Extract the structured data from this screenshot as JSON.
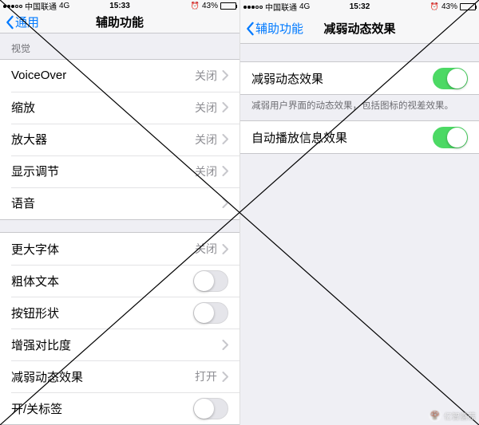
{
  "left": {
    "status": {
      "carrier": "中国联通",
      "net": "4G",
      "time": "15:33",
      "battery_pct": "43%",
      "battery_fill": 43
    },
    "nav": {
      "back": "通用",
      "title": "辅助功能"
    },
    "section1_header": "视觉",
    "rows1": [
      {
        "label": "VoiceOver",
        "value": "关闭",
        "type": "disclosure"
      },
      {
        "label": "缩放",
        "value": "关闭",
        "type": "disclosure"
      },
      {
        "label": "放大器",
        "value": "关闭",
        "type": "disclosure"
      },
      {
        "label": "显示调节",
        "value": "关闭",
        "type": "disclosure"
      },
      {
        "label": "语音",
        "value": "",
        "type": "disclosure"
      }
    ],
    "rows2": [
      {
        "label": "更大字体",
        "value": "关闭",
        "type": "disclosure"
      },
      {
        "label": "粗体文本",
        "type": "toggle",
        "on": false
      },
      {
        "label": "按钮形状",
        "type": "toggle",
        "on": false
      },
      {
        "label": "增强对比度",
        "value": "",
        "type": "disclosure"
      },
      {
        "label": "减弱动态效果",
        "value": "打开",
        "type": "disclosure"
      },
      {
        "label": "开/关标签",
        "type": "toggle",
        "on": false
      }
    ]
  },
  "right": {
    "status": {
      "carrier": "中国联通",
      "net": "4G",
      "time": "15:32",
      "battery_pct": "43%",
      "battery_fill": 43
    },
    "nav": {
      "back": "辅助功能",
      "title": "减弱动态效果"
    },
    "rows": [
      {
        "label": "减弱动态效果",
        "type": "toggle",
        "on": true
      }
    ],
    "footer": "减弱用户界面的动态效果，包括图标的视差效果。",
    "rows2": [
      {
        "label": "自动播放信息效果",
        "type": "toggle",
        "on": true
      }
    ]
  },
  "watermark": "亿智蘑菇"
}
